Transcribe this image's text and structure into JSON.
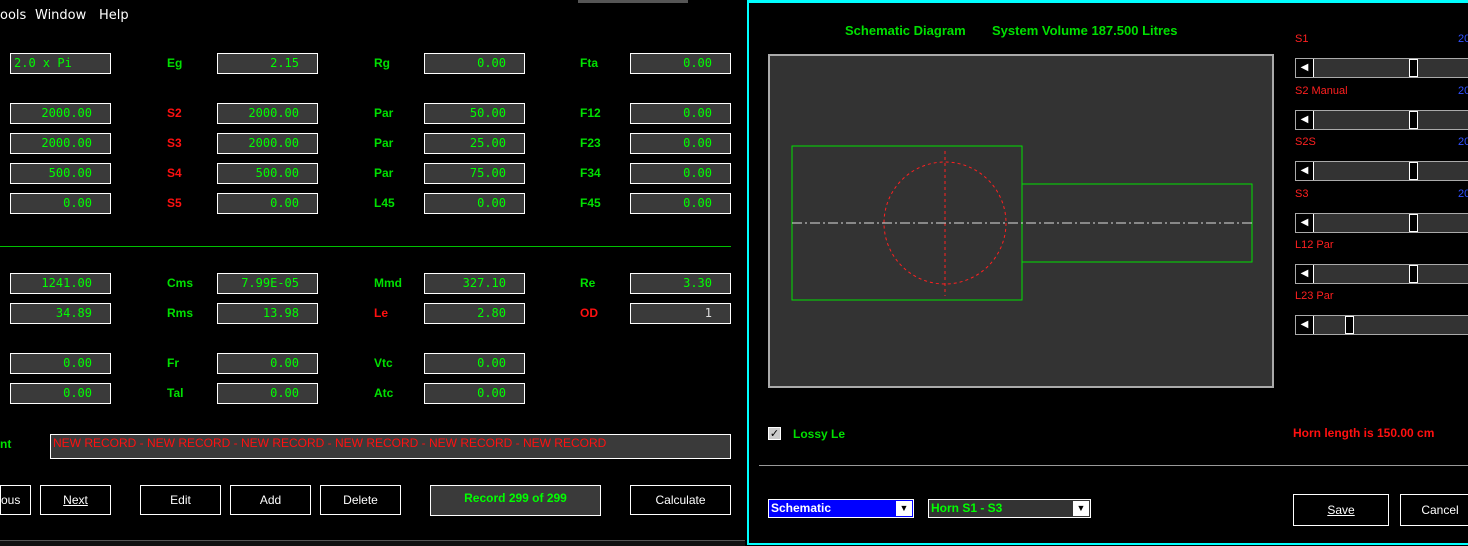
{
  "menu": {
    "items": [
      "ools",
      "Window",
      "Help"
    ]
  },
  "form": {
    "rows": [
      {
        "c1": "2.0 x Pi",
        "l2": "Eg",
        "c2": "2.15",
        "l3": "Rg",
        "c3": "0.00",
        "l4": "Fta",
        "c4": "0.00"
      },
      {
        "c1": "2000.00",
        "l2": "S2",
        "c2": "2000.00",
        "l3": "Par",
        "c3": "50.00",
        "l4": "F12",
        "c4": "0.00"
      },
      {
        "c1": "2000.00",
        "l2": "S3",
        "c2": "2000.00",
        "l3": "Par",
        "c3": "25.00",
        "l4": "F23",
        "c4": "0.00"
      },
      {
        "c1": "500.00",
        "l2": "S4",
        "c2": "500.00",
        "l3": "Par",
        "c3": "75.00",
        "l4": "F34",
        "c4": "0.00"
      },
      {
        "c1": "0.00",
        "l2": "S5",
        "c2": "0.00",
        "l3": "L45",
        "c3": "0.00",
        "l4": "F45",
        "c4": "0.00"
      },
      {
        "c1": "1241.00",
        "l2": "Cms",
        "c2": "7.99E-05",
        "l3": "Mmd",
        "c3": "327.10",
        "l4": "Re",
        "c4": "3.30"
      },
      {
        "c1": "34.89",
        "l2": "Rms",
        "c2": "13.98",
        "l3": "Le",
        "c3": "2.80",
        "l4": "OD",
        "c4": "1"
      },
      {
        "c1": "0.00",
        "l2": "Fr",
        "c2": "0.00",
        "l3": "Vtc",
        "c3": "0.00"
      },
      {
        "c1": "0.00",
        "l2": "Tal",
        "c2": "0.00",
        "l3": "Atc",
        "c3": "0.00"
      }
    ],
    "comment_label": "nt",
    "comment": "NEW RECORD - NEW RECORD - NEW RECORD - NEW RECORD - NEW RECORD - NEW RECORD",
    "buttons": {
      "previous": "ous",
      "next": "Next",
      "edit": "Edit",
      "add": "Add",
      "delete": "Delete",
      "calculate": "Calculate"
    },
    "record_status": "Record 299 of 299"
  },
  "schematic": {
    "title": "Schematic Diagram",
    "volume": "System Volume 187.500 Litres",
    "sliders": [
      {
        "label": "S1",
        "value": "20",
        "level": 0.62
      },
      {
        "label": "S2  Manual",
        "value": "20",
        "level": 0.62
      },
      {
        "label": "S2S",
        "value": "20",
        "level": 0.62
      },
      {
        "label": "S3",
        "value": "20",
        "level": 0.62
      },
      {
        "label": "L12  Par",
        "value": "",
        "level": 0.62
      },
      {
        "label": "L23  Par",
        "value": "",
        "level": 0.2
      }
    ],
    "lossy_label": "Lossy Le",
    "lossy_checked": true,
    "horn_length": "Horn length is 150.00 cm",
    "view_select": "Schematic",
    "section_select": "Horn S1 - S3",
    "save": "Save",
    "cancel": "Cancel"
  },
  "colors": {
    "field_text": "#00ff00",
    "label_red": "#ff1010",
    "label_green": "#00e000",
    "accent": "#00ffff"
  }
}
